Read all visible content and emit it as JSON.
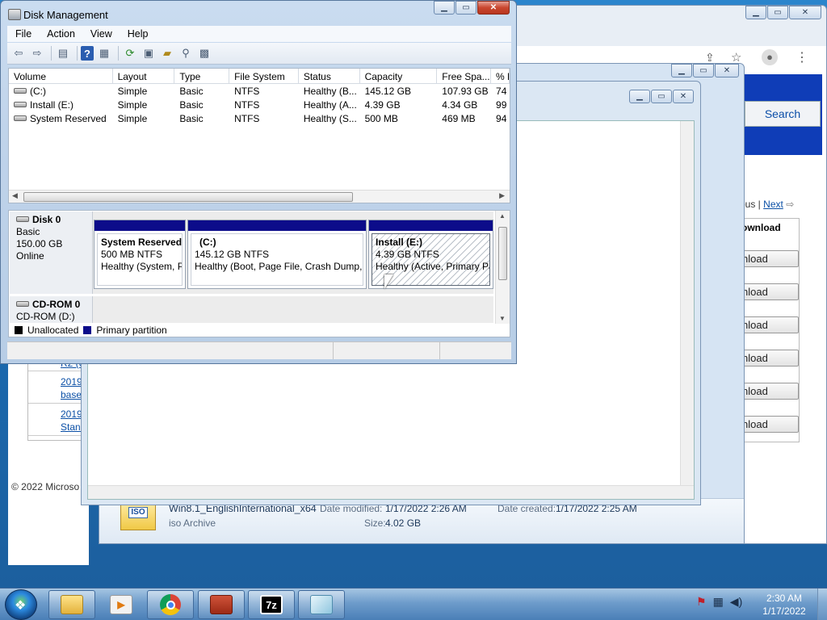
{
  "disk_management": {
    "title": "Disk Management",
    "menu": [
      "File",
      "Action",
      "View",
      "Help"
    ],
    "columns": [
      "Volume",
      "Layout",
      "Type",
      "File System",
      "Status",
      "Capacity",
      "Free Spa...",
      "% F"
    ],
    "volumes": [
      {
        "volume": "(C:)",
        "layout": "Simple",
        "type": "Basic",
        "fs": "NTFS",
        "status": "Healthy (B...",
        "capacity": "145.12 GB",
        "free": "107.93 GB",
        "pct": "74"
      },
      {
        "volume": "Install (E:)",
        "layout": "Simple",
        "type": "Basic",
        "fs": "NTFS",
        "status": "Healthy (A...",
        "capacity": "4.39 GB",
        "free": "4.34 GB",
        "pct": "99"
      },
      {
        "volume": "System Reserved",
        "layout": "Simple",
        "type": "Basic",
        "fs": "NTFS",
        "status": "Healthy (S...",
        "capacity": "500 MB",
        "free": "469 MB",
        "pct": "94"
      }
    ],
    "disk0": {
      "name": "Disk 0",
      "kind": "Basic",
      "size": "150.00 GB",
      "state": "Online",
      "partitions": [
        {
          "name": "System Reserved",
          "size": "500 MB NTFS",
          "status": "Healthy (System, P"
        },
        {
          "name": "(C:)",
          "size": "145.12 GB NTFS",
          "status": "Healthy (Boot, Page File, Crash Dump, P"
        },
        {
          "name": "Install  (E:)",
          "size": "4.39 GB NTFS",
          "status": "Healthy (Active, Primary Pa"
        }
      ]
    },
    "cdrom": {
      "name": "CD-ROM 0",
      "label": "CD-ROM (D:)"
    },
    "legend": [
      {
        "label": "Unallocated",
        "color": "#000000"
      },
      {
        "label": "Primary partition",
        "color": "#0c0c8a"
      }
    ]
  },
  "explorer": {
    "file_name": "Win8.1_EnglishInternational_x64",
    "file_type": "iso Archive",
    "modified_label": "Date modified:",
    "modified": "1/17/2022 2:26 AM",
    "created_label": "Date created:",
    "created": "1/17/2022 2:25 AM",
    "size_label": "Size:",
    "size": "4.02 GB",
    "icon_text": "ISO"
  },
  "browser": {
    "search_button": "Search",
    "prev_text": "ous |",
    "next_text": "Next",
    "download_header": "ownload",
    "download_buttons": [
      "nload",
      "nload",
      "nload",
      "nload",
      "nload",
      "nload"
    ],
    "size_suffixes": [
      "B",
      "B",
      "B",
      "B"
    ],
    "left_links": [
      "R2 (6",
      "2019\nbase",
      "2019\nStand"
    ],
    "copyright": "© 2022 Microso"
  },
  "taskbar": {
    "time": "2:30 AM",
    "date": "1/17/2022",
    "apps": [
      "explorer",
      "media-player",
      "chrome",
      "toolbox",
      "7zip",
      "notepad"
    ]
  }
}
